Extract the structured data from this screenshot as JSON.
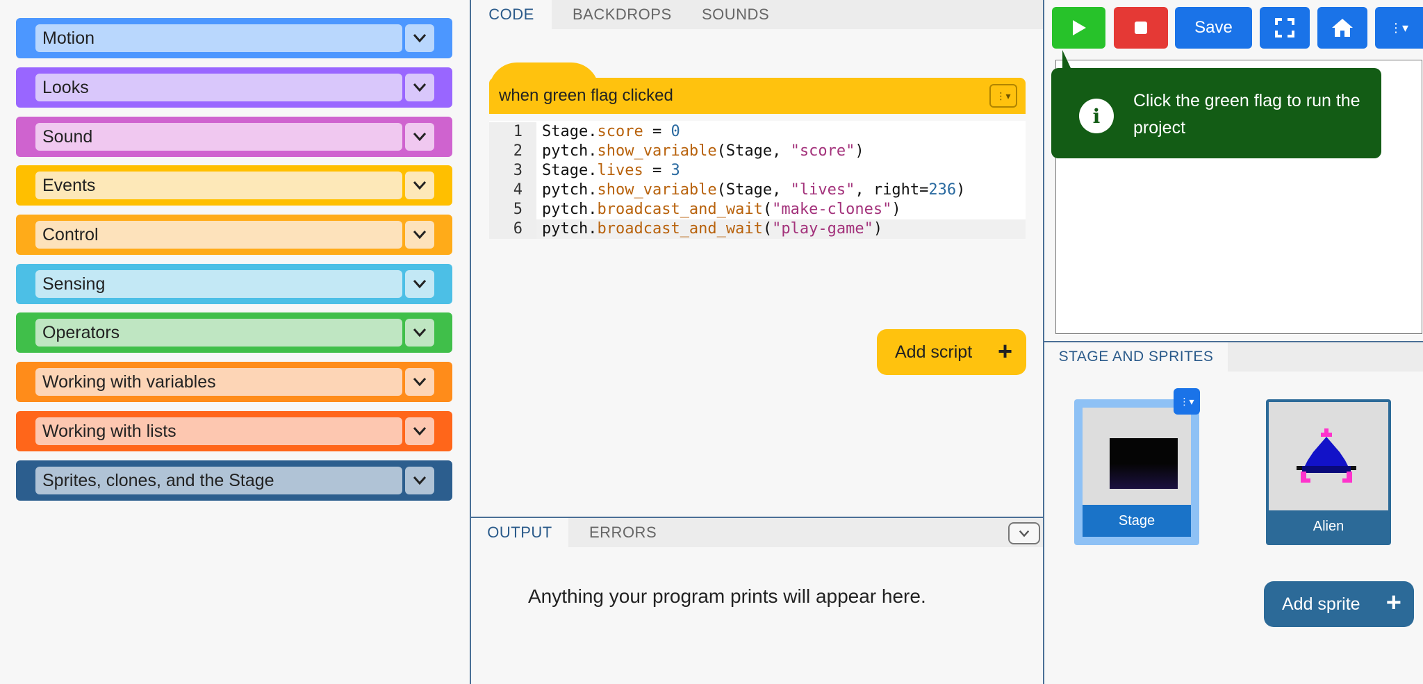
{
  "palette": {
    "categories": [
      {
        "label": "Motion",
        "bg": "#4c97ff",
        "inner": "#b9d7fd"
      },
      {
        "label": "Looks",
        "bg": "#9966ff",
        "inner": "#d9c7fb"
      },
      {
        "label": "Sound",
        "bg": "#cf63cf",
        "inner": "#f0c8f0"
      },
      {
        "label": "Events",
        "bg": "#ffbf00",
        "inner": "#fde8b8"
      },
      {
        "label": "Control",
        "bg": "#ffab19",
        "inner": "#fde2bb"
      },
      {
        "label": "Sensing",
        "bg": "#4cbfe6",
        "inner": "#c3e8f5"
      },
      {
        "label": "Operators",
        "bg": "#40bf4a",
        "inner": "#bfe6c2"
      },
      {
        "label": "Working with variables",
        "bg": "#ff8c1a",
        "inner": "#fdd5b6"
      },
      {
        "label": "Working with lists",
        "bg": "#ff661a",
        "inner": "#fdc7b0"
      },
      {
        "label": "Sprites, clones, and the Stage",
        "bg": "#2c5e8e",
        "inner": "#b0c3d6"
      }
    ]
  },
  "code_tabs": [
    "CODE",
    "BACKDROPS",
    "SOUNDS"
  ],
  "script": {
    "hat_label": "when green flag clicked",
    "line_numbers": [
      "1",
      "2",
      "3",
      "4",
      "5",
      "6"
    ]
  },
  "add_script_label": "Add script",
  "output_tabs": [
    "OUTPUT",
    "ERRORS"
  ],
  "output_placeholder": "Anything your program prints will appear here.",
  "toolbar": {
    "save_label": "Save"
  },
  "tooltip": {
    "message": "Click the green flag to run the project"
  },
  "sprites_tab": "STAGE AND SPRITES",
  "sprites": [
    {
      "name": "Stage"
    },
    {
      "name": "Alien"
    }
  ],
  "add_sprite_label": "Add sprite",
  "colors": {
    "green_flag": "#27c22a",
    "stop": "#e53935",
    "toolbar_blue": "#1a73e8",
    "script_yellow": "#ffc20e",
    "tooltip_green": "#135c15"
  }
}
